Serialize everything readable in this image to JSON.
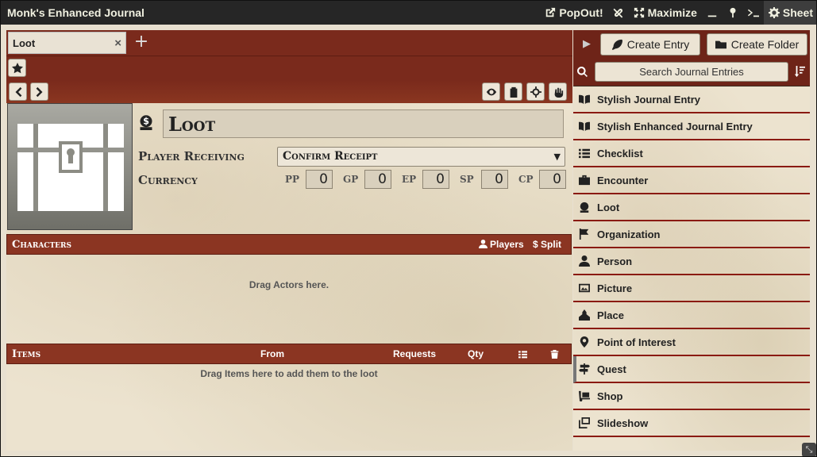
{
  "window": {
    "title": "Monk's Enhanced Journal",
    "controls": {
      "popout": "PopOut!",
      "maximize": "Maximize",
      "sheet": "Sheet"
    }
  },
  "tabs": [
    {
      "label": "Loot",
      "close": "×"
    }
  ],
  "tab_add": "+",
  "entry": {
    "name": "Loot",
    "player_receiving_label": "Player Receiving",
    "player_receiving_value": "Confirm Receipt",
    "currency_label": "Currency",
    "currency": [
      {
        "label": "PP",
        "value": "0"
      },
      {
        "label": "GP",
        "value": "0"
      },
      {
        "label": "EP",
        "value": "0"
      },
      {
        "label": "SP",
        "value": "0"
      },
      {
        "label": "CP",
        "value": "0"
      }
    ]
  },
  "characters": {
    "title": "Characters",
    "players": "Players",
    "split": "Split",
    "empty": "Drag Actors here."
  },
  "items": {
    "title": "Items",
    "col_from": "From",
    "col_requests": "Requests",
    "col_qty": "Qty",
    "empty": "Drag Items here to add them to the loot"
  },
  "sidebar": {
    "create_entry": "Create Entry",
    "create_folder": "Create Folder",
    "search_placeholder": "Search Journal Entries",
    "items": [
      {
        "label": "Stylish Journal Entry",
        "icon": "book-open-icon"
      },
      {
        "label": "Stylish Enhanced Journal Entry",
        "icon": "book-open-icon"
      },
      {
        "label": "Checklist",
        "icon": "list-icon"
      },
      {
        "label": "Encounter",
        "icon": "toolbox-icon"
      },
      {
        "label": "Loot",
        "icon": "coin-bag-icon"
      },
      {
        "label": "Organization",
        "icon": "flag-icon"
      },
      {
        "label": "Person",
        "icon": "user-icon"
      },
      {
        "label": "Picture",
        "icon": "image-icon"
      },
      {
        "label": "Place",
        "icon": "place-icon"
      },
      {
        "label": "Point of Interest",
        "icon": "map-marker-icon"
      },
      {
        "label": "Quest",
        "icon": "signpost-icon"
      },
      {
        "label": "Shop",
        "icon": "dolly-icon"
      },
      {
        "label": "Slideshow",
        "icon": "images-icon"
      }
    ]
  }
}
